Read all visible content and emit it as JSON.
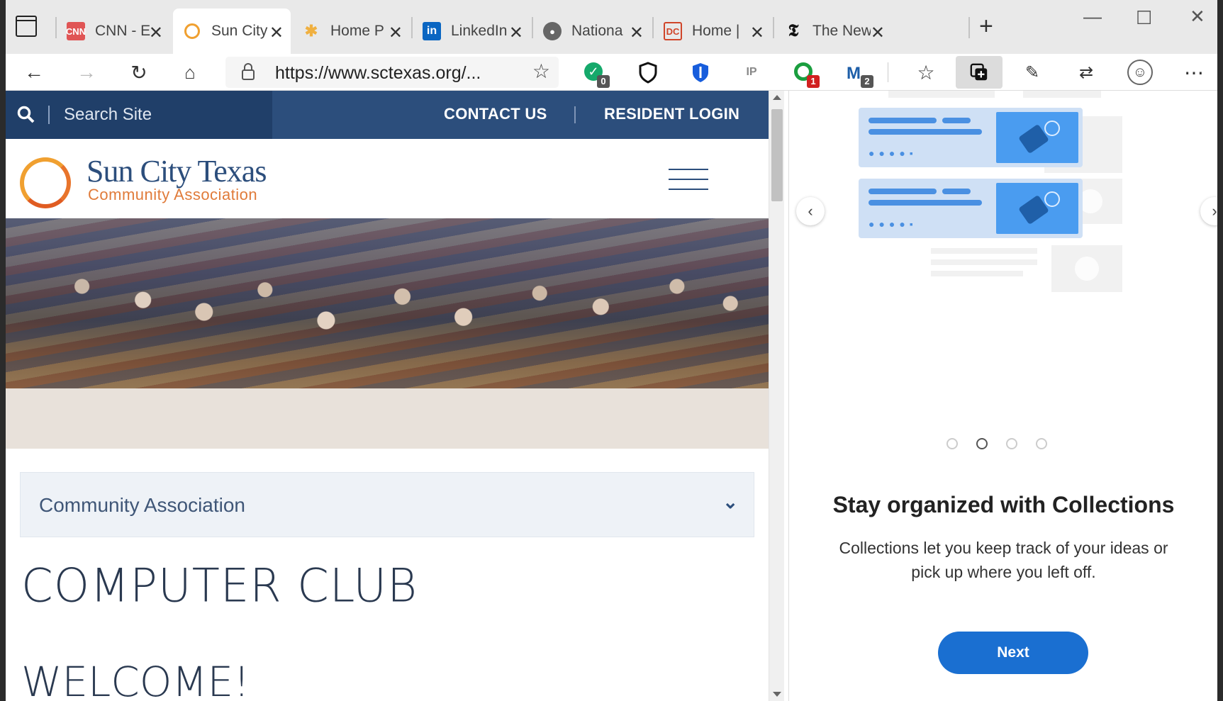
{
  "browser": {
    "tabs": [
      {
        "title": "CNN - E",
        "favicon": "cnn-icon",
        "color": "#cc0000"
      },
      {
        "title": "Sun City",
        "favicon": "sun-city-icon",
        "color": "#f0a030"
      },
      {
        "title": "Home P",
        "favicon": "home-p-icon",
        "color": "#f0b040"
      },
      {
        "title": "LinkedIn",
        "favicon": "linkedin-icon",
        "color": "#0a66c2"
      },
      {
        "title": "Nationa",
        "favicon": "national-icon",
        "color": "#555555"
      },
      {
        "title": "Home |",
        "favicon": "home-icon",
        "color": "#d0452a"
      },
      {
        "title": "The New",
        "favicon": "nyt-icon",
        "color": "#111111"
      }
    ],
    "url": "https://www.sctexas.org/...",
    "extension_badges": {
      "grammarly": "0",
      "green_ext": "1",
      "mail_ext": "2"
    }
  },
  "site": {
    "search_label": "Search Site",
    "contact_label": "CONTACT US",
    "login_label": "RESIDENT LOGIN",
    "logo_name": "Sun City Texas",
    "logo_sub": "Community Association",
    "dropdown_label": "Community Association",
    "heading": "COMPUTER CLUB",
    "subheading": "WELCOME!"
  },
  "collections": {
    "title": "Stay organized with Collections",
    "description": "Collections let you keep track of your ideas or pick up where you left off.",
    "next_label": "Next",
    "page_index": 2,
    "page_count": 4
  }
}
